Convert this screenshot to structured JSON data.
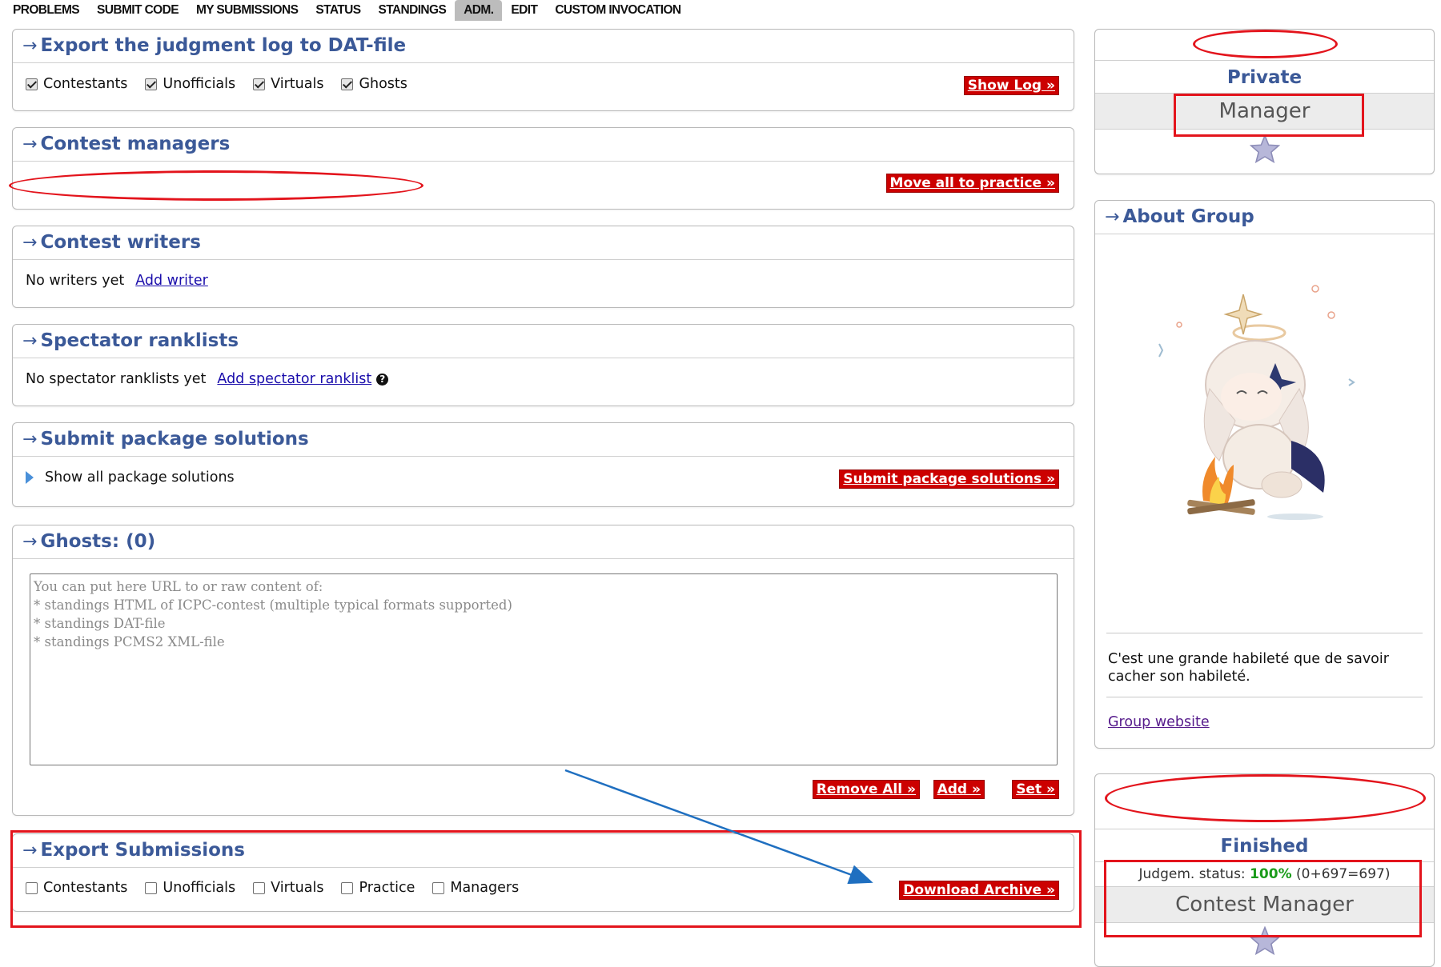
{
  "nav": {
    "items": [
      "PROBLEMS",
      "SUBMIT CODE",
      "MY SUBMISSIONS",
      "STATUS",
      "STANDINGS",
      "ADM.",
      "EDIT",
      "CUSTOM INVOCATION"
    ],
    "active": "ADM."
  },
  "export_log": {
    "title": "Export the judgment log to DAT-file",
    "checkboxes": [
      {
        "label": "Contestants",
        "checked": true
      },
      {
        "label": "Unofficials",
        "checked": true
      },
      {
        "label": "Virtuals",
        "checked": true
      },
      {
        "label": "Ghosts",
        "checked": true
      }
    ],
    "button": "Show Log »"
  },
  "managers": {
    "title": "Contest managers",
    "button": "Move all to practice »"
  },
  "writers": {
    "title": "Contest writers",
    "empty_text": "No writers yet",
    "add_link": "Add writer"
  },
  "spectator": {
    "title": "Spectator ranklists",
    "empty_text": "No spectator ranklists yet",
    "add_link": "Add spectator ranklist",
    "help_icon": "question-circle-icon"
  },
  "package": {
    "title": "Submit package solutions",
    "toggle_label": "Show all package solutions",
    "button": "Submit package solutions »"
  },
  "ghosts": {
    "title": "Ghosts: (0)",
    "placeholder": "You can put here URL to or raw content of:\n* standings HTML of ICPC-contest (multiple typical formats supported)\n* standings DAT-file\n* standings PCMS2 XML-file",
    "buttons": [
      "Remove All »",
      "Add »",
      "Set »"
    ]
  },
  "export_submissions": {
    "title": "Export Submissions",
    "checkboxes": [
      {
        "label": "Contestants",
        "checked": false
      },
      {
        "label": "Unofficials",
        "checked": false
      },
      {
        "label": "Virtuals",
        "checked": false
      },
      {
        "label": "Practice",
        "checked": false
      },
      {
        "label": "Managers",
        "checked": false
      }
    ],
    "button": "Download Archive »"
  },
  "group_card": {
    "visibility": "Private",
    "role": "Manager"
  },
  "about_group": {
    "title": "About Group",
    "quote": "C'est une grande habileté que de savoir cacher son habileté.",
    "website_link": "Group website"
  },
  "contest_card": {
    "phase": "Finished",
    "judgem_label": "Judgem. status:",
    "judgem_pct": "100%",
    "judgem_detail": "(0+697=697)",
    "role": "Contest Manager"
  },
  "colors": {
    "caption": "#3b5998",
    "button_red": "#cc0000",
    "annotation_red": "#e3141c",
    "annotation_arrow": "#1f6fc0",
    "status_green": "#1b9c1b"
  }
}
